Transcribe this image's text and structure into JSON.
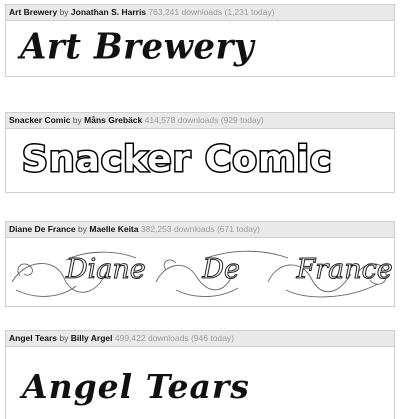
{
  "fonts": [
    {
      "name": "Art Brewery",
      "by": "by",
      "author": "Jonathan S. Harris",
      "stats": "763,241 downloads (1,231 today)",
      "preview": "Art Brewery"
    },
    {
      "name": "Snacker Comic",
      "by": "by",
      "author": "Måns Grebäck",
      "stats": "414,578 downloads (929 today)",
      "preview": "Snacker Comic"
    },
    {
      "name": "Diane De France",
      "by": "by",
      "author": "Maelle Keita",
      "stats": "382,253 downloads (671 today)",
      "preview": "Diane De France"
    },
    {
      "name": "Angel Tears",
      "by": "by",
      "author": "Billy Argel",
      "stats": "499,422 downloads (946 today)",
      "preview": "Angel Tears"
    }
  ]
}
